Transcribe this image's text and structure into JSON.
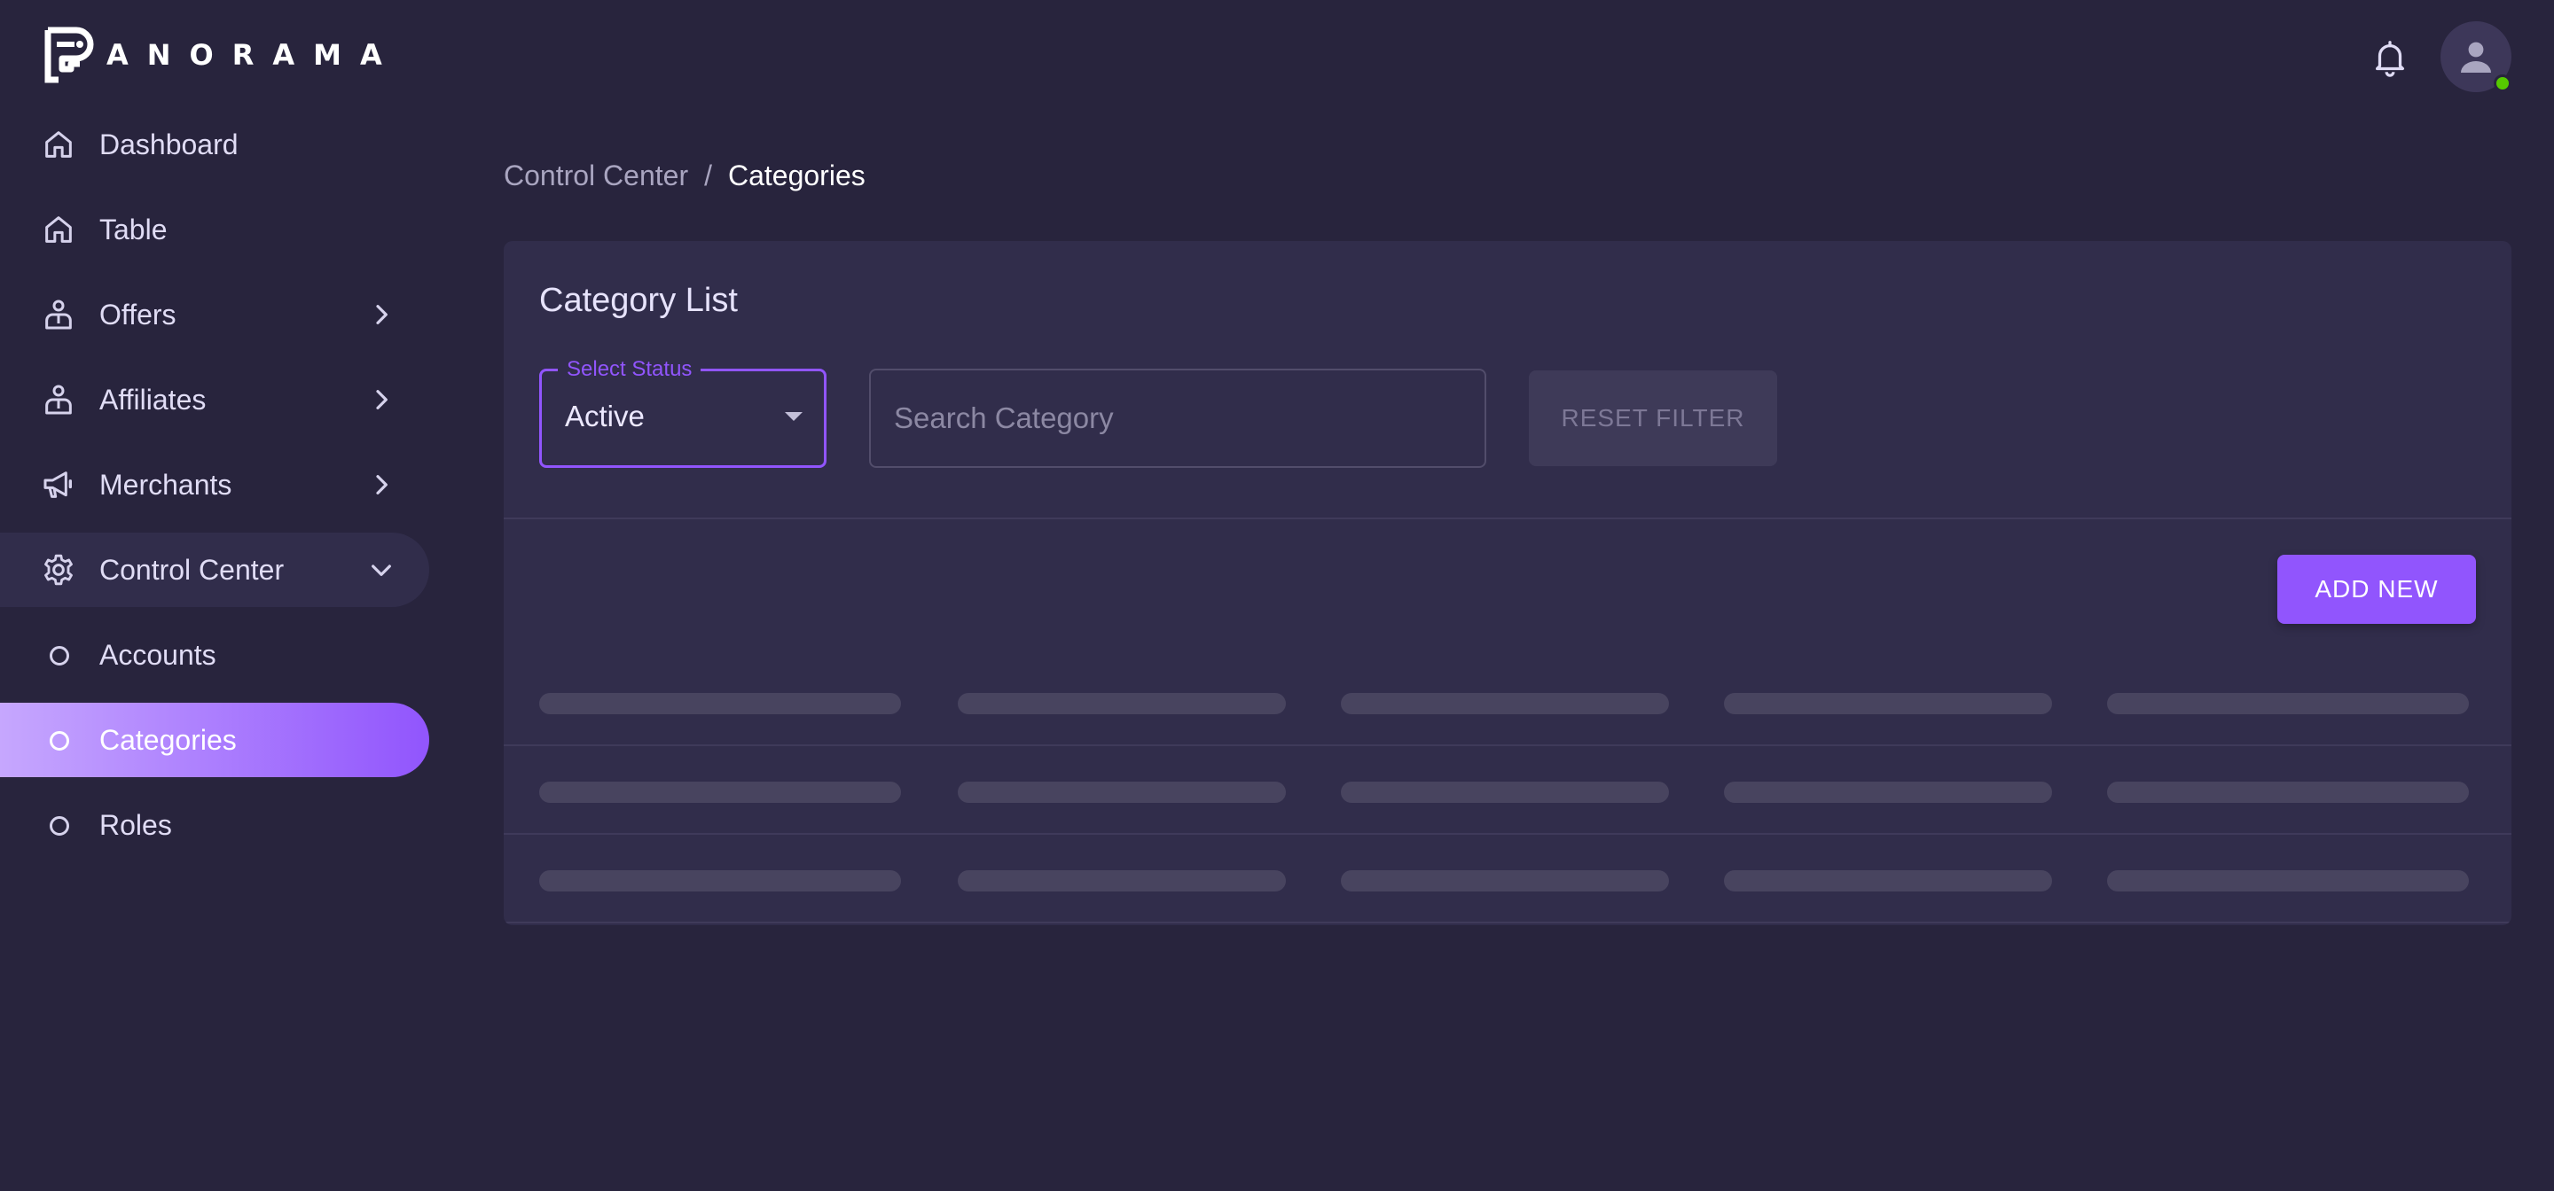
{
  "app": {
    "logo_text": "ANORAMA",
    "accent_color": "#9155fd",
    "online_status_color": "#56ca00"
  },
  "sidebar": {
    "items": [
      {
        "label": "Dashboard",
        "icon": "home-icon"
      },
      {
        "label": "Table",
        "icon": "home-icon"
      },
      {
        "label": "Offers",
        "icon": "account-tie-icon",
        "chevron": "chevron-right-icon"
      },
      {
        "label": "Affiliates",
        "icon": "account-tie-icon",
        "chevron": "chevron-right-icon"
      },
      {
        "label": "Merchants",
        "icon": "megaphone-icon",
        "chevron": "chevron-right-icon"
      },
      {
        "label": "Control Center",
        "icon": "gear-icon",
        "chevron": "chevron-down-icon",
        "expanded": true
      },
      {
        "label": "Accounts",
        "icon": "circle-outline-icon"
      },
      {
        "label": "Categories",
        "icon": "circle-outline-icon",
        "active": true
      },
      {
        "label": "Roles",
        "icon": "circle-outline-icon"
      }
    ]
  },
  "header": {
    "notification_icon": "bell-icon",
    "avatar_icon": "user-icon"
  },
  "breadcrumb": {
    "parent": "Control Center",
    "separator": "/",
    "current": "Categories"
  },
  "card": {
    "title": "Category List",
    "status_select": {
      "label": "Select Status",
      "value": "Active"
    },
    "search": {
      "placeholder": "Search Category",
      "value": ""
    },
    "reset_label": "RESET FILTER",
    "add_label": "ADD NEW",
    "loading_rows": 3,
    "loading_columns": 5
  }
}
